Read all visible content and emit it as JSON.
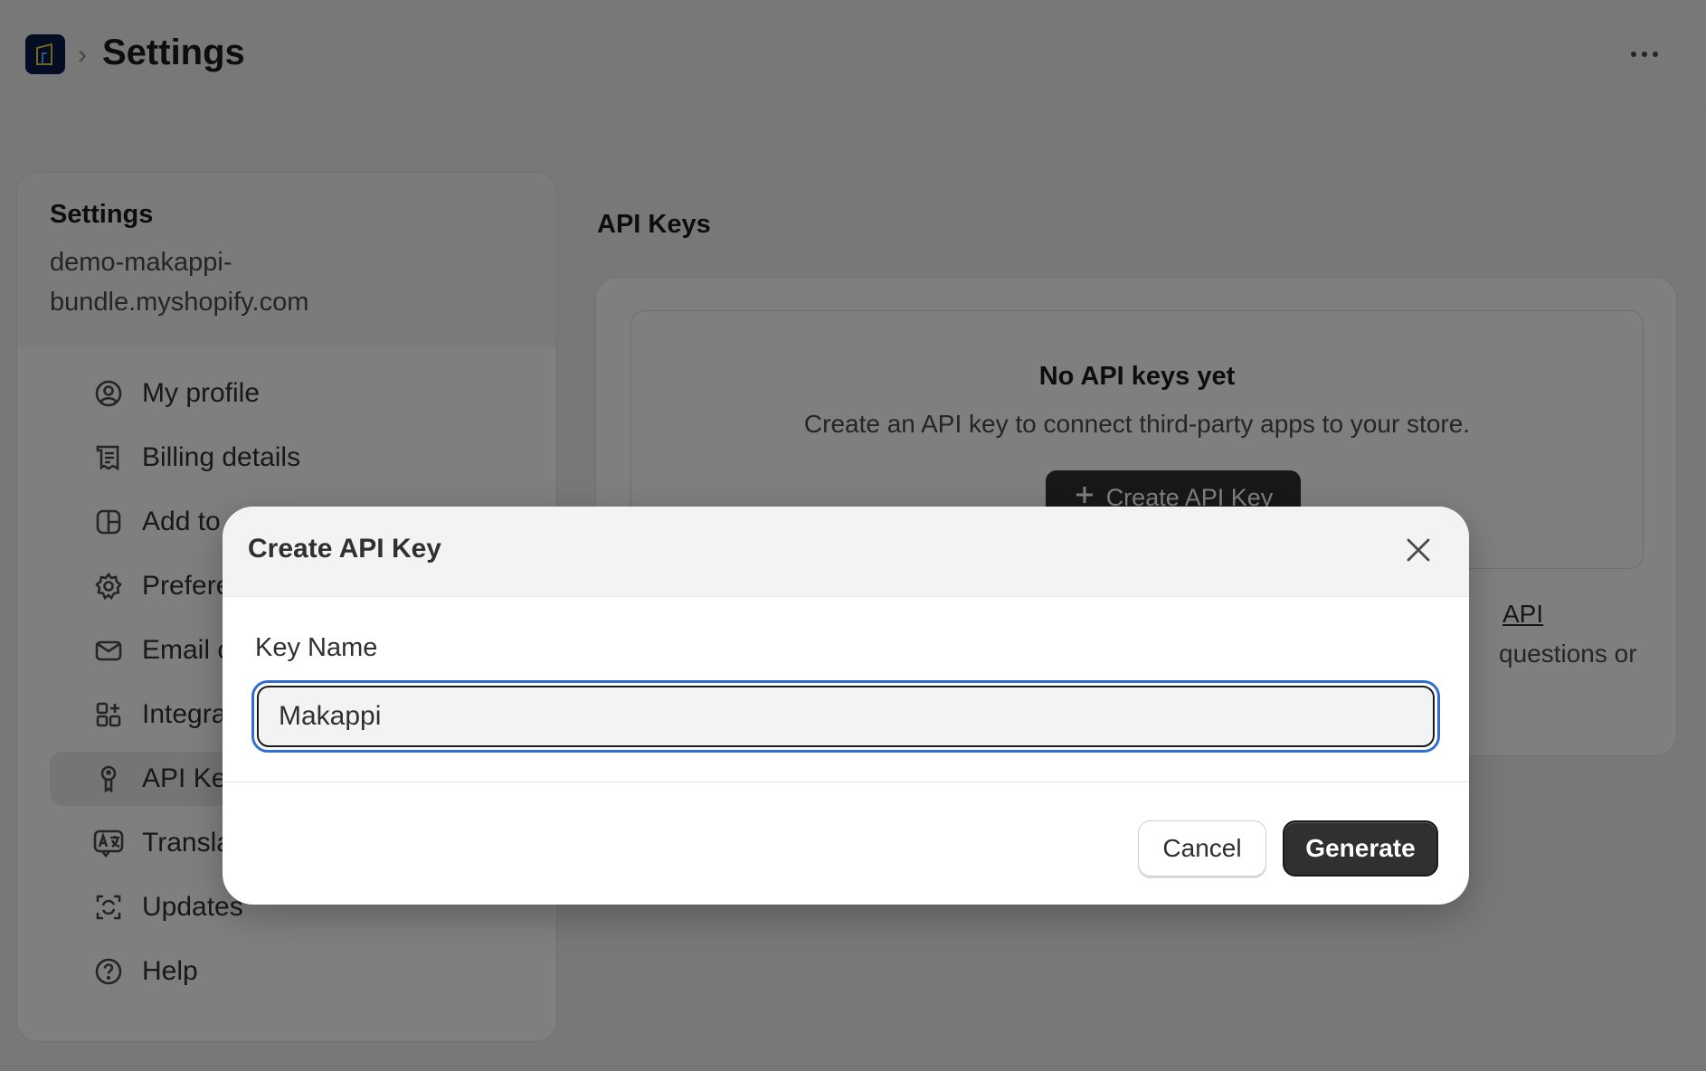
{
  "header": {
    "title": "Settings",
    "breadcrumb_separator": "›"
  },
  "sidebar": {
    "title": "Settings",
    "store_url": "demo-makappi-bundle.myshopify.com",
    "items": [
      {
        "label": "My profile",
        "icon": "user-circle-icon"
      },
      {
        "label": "Billing details",
        "icon": "receipt-icon"
      },
      {
        "label": "Add to",
        "icon": "layout-icon"
      },
      {
        "label": "Prefere",
        "icon": "gear-icon"
      },
      {
        "label": "Email c",
        "icon": "envelope-icon"
      },
      {
        "label": "Integra",
        "icon": "apps-icon"
      },
      {
        "label": "API Key",
        "icon": "key-icon",
        "active": true
      },
      {
        "label": "Transla",
        "icon": "translate-icon"
      },
      {
        "label": "Updates",
        "icon": "refresh-icon"
      },
      {
        "label": "Help",
        "icon": "question-circle-icon"
      }
    ]
  },
  "main": {
    "title": "API Keys",
    "empty_title": "No API keys yet",
    "empty_description": "Create an API key to connect third-party apps to your store.",
    "create_button": "Create API Key",
    "footer_link_fragment": "API",
    "footer_text_fragment": "questions or"
  },
  "modal": {
    "title": "Create API Key",
    "field_label": "Key Name",
    "field_value": "Makappi",
    "cancel_label": "Cancel",
    "generate_label": "Generate"
  },
  "colors": {
    "accent_focus": "#2f6fd1",
    "primary_button": "#303030",
    "logo_bg": "#0b1a4a"
  }
}
